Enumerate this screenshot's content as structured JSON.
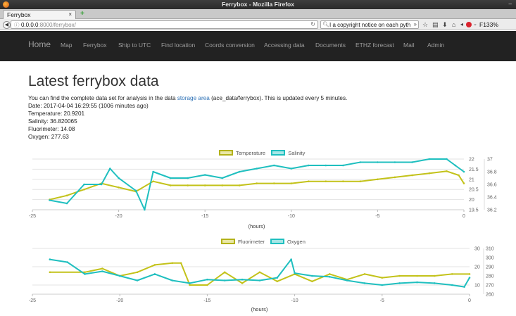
{
  "window": {
    "title": "Ferrybox - Mozilla Firefox"
  },
  "tab": {
    "label": "Ferrybox",
    "close": "×",
    "new_tab": "+"
  },
  "urlbar": {
    "host": "0.0.0.0",
    "path": ":8000/ferrybox/",
    "info_icon": "ⓘ",
    "reload_icon": "reload-icon"
  },
  "searchbar": {
    "query": "I a copyright notice on each pyth",
    "go": "»"
  },
  "toolbar": {
    "zoom": "F133%"
  },
  "sitenav": {
    "items": [
      {
        "label": "Home"
      },
      {
        "label": "Map"
      },
      {
        "label": "Ferrybox"
      },
      {
        "label": "Ship to UTC"
      },
      {
        "label": "Find location"
      },
      {
        "label": "Coords conversion"
      },
      {
        "label": "Accessing data"
      },
      {
        "label": "Documents"
      },
      {
        "label": "ETHZ forecast"
      },
      {
        "label": "Mail"
      },
      {
        "label": "Admin"
      }
    ]
  },
  "page": {
    "title": "Latest ferrybox data",
    "intro_before": "You can find the complete data set for analysis in the data ",
    "intro_link": "storage area",
    "intro_after": " (ace_data/ferrybox). This is updated every 5 minutes.",
    "date": "Date: 2017-04-04 16:29:55 (1006 minutes ago)",
    "temperature": "Temperature: 20.9201",
    "salinity": "Salinity: 36.820065",
    "fluorimeter": "Fluorimeter: 14.08",
    "oxygen": "Oxygen: 277.63"
  },
  "colors": {
    "temperature": "#c3c21a",
    "salinity": "#1fbfbf",
    "fluorimeter": "#c3c21a",
    "oxygen": "#1fbfbf"
  },
  "chart_data": [
    {
      "type": "line",
      "legend_position": "top-center",
      "xlabel": "(hours)",
      "xlim": [
        -25,
        0
      ],
      "x_ticks": [
        -25,
        -20,
        -15,
        -10,
        -5,
        0
      ],
      "grid": true,
      "series": [
        {
          "name": "Temperature",
          "axis": "left",
          "ylim": [
            19.5,
            22.0
          ],
          "x": [
            -24,
            -23,
            -22,
            -21,
            -20,
            -19,
            -18,
            -17,
            -16,
            -15,
            -14,
            -13,
            -12,
            -11,
            -10,
            -9,
            -8,
            -7,
            -6,
            -5,
            -4,
            -3,
            -2,
            -1,
            -0.3,
            0
          ],
          "values": [
            20.0,
            20.2,
            20.5,
            20.8,
            20.6,
            20.4,
            20.9,
            20.7,
            20.7,
            20.7,
            20.7,
            20.7,
            20.8,
            20.8,
            20.8,
            20.9,
            20.9,
            20.9,
            20.9,
            21.0,
            21.1,
            21.2,
            21.3,
            21.4,
            21.2,
            20.8
          ]
        },
        {
          "name": "Salinity",
          "axis": "right",
          "ylim": [
            36.2,
            37.0
          ],
          "x": [
            -24,
            -23,
            -22,
            -21,
            -20.5,
            -20,
            -19,
            -18.5,
            -18,
            -17,
            -16,
            -15,
            -14,
            -13,
            -12,
            -11,
            -10,
            -9,
            -8,
            -7,
            -6,
            -5,
            -4,
            -3,
            -2,
            -1,
            -0.5,
            0
          ],
          "values": [
            36.35,
            36.3,
            36.6,
            36.6,
            36.85,
            36.7,
            36.5,
            36.2,
            36.8,
            36.7,
            36.7,
            36.75,
            36.7,
            36.8,
            36.85,
            36.9,
            36.85,
            36.9,
            36.9,
            36.9,
            36.95,
            36.95,
            36.95,
            36.95,
            37.0,
            37.0,
            36.9,
            36.8
          ]
        }
      ],
      "y_ticks_left": [
        19.5,
        20.0,
        20.5,
        21.0,
        21.5,
        22.0
      ],
      "y_ticks_right": [
        36.2,
        36.4,
        36.6,
        36.8,
        37.0
      ]
    },
    {
      "type": "line",
      "legend_position": "top-center",
      "xlabel": "(hours)",
      "xlim": [
        -25,
        0
      ],
      "x_ticks": [
        -25,
        -20,
        -15,
        -10,
        -5,
        0
      ],
      "grid": true,
      "series": [
        {
          "name": "Fluorimeter",
          "axis": "left",
          "ylim": [
            5,
            30
          ],
          "x": [
            -24,
            -22,
            -21,
            -20,
            -19,
            -18,
            -17,
            -16.5,
            -16,
            -15,
            -14,
            -13,
            -12,
            -11,
            -10,
            -9,
            -8,
            -7,
            -6,
            -5,
            -4,
            -3,
            -2,
            -1,
            0
          ],
          "values": [
            17,
            17,
            19,
            15,
            17,
            21,
            22,
            22,
            10,
            10,
            17,
            11,
            17,
            12,
            16,
            12,
            16,
            13,
            16,
            14,
            15,
            15,
            15,
            16,
            16
          ]
        },
        {
          "name": "Oxygen",
          "axis": "right",
          "ylim": [
            260,
            310
          ],
          "x": [
            -24,
            -23,
            -22,
            -21,
            -20,
            -19,
            -18,
            -17,
            -16,
            -15,
            -14,
            -13,
            -12,
            -11,
            -10.2,
            -10,
            -9,
            -8,
            -7,
            -6,
            -5,
            -4,
            -3,
            -2,
            -1,
            -0.3,
            0
          ],
          "values": [
            298,
            295,
            282,
            285,
            280,
            275,
            282,
            275,
            272,
            276,
            275,
            276,
            275,
            278,
            298,
            283,
            280,
            279,
            275,
            272,
            270,
            272,
            273,
            272,
            270,
            268,
            278
          ]
        }
      ],
      "y_ticks_left": [
        10,
        20,
        30
      ],
      "y_ticks_right": [
        260,
        270,
        280,
        290,
        300,
        310
      ]
    }
  ]
}
